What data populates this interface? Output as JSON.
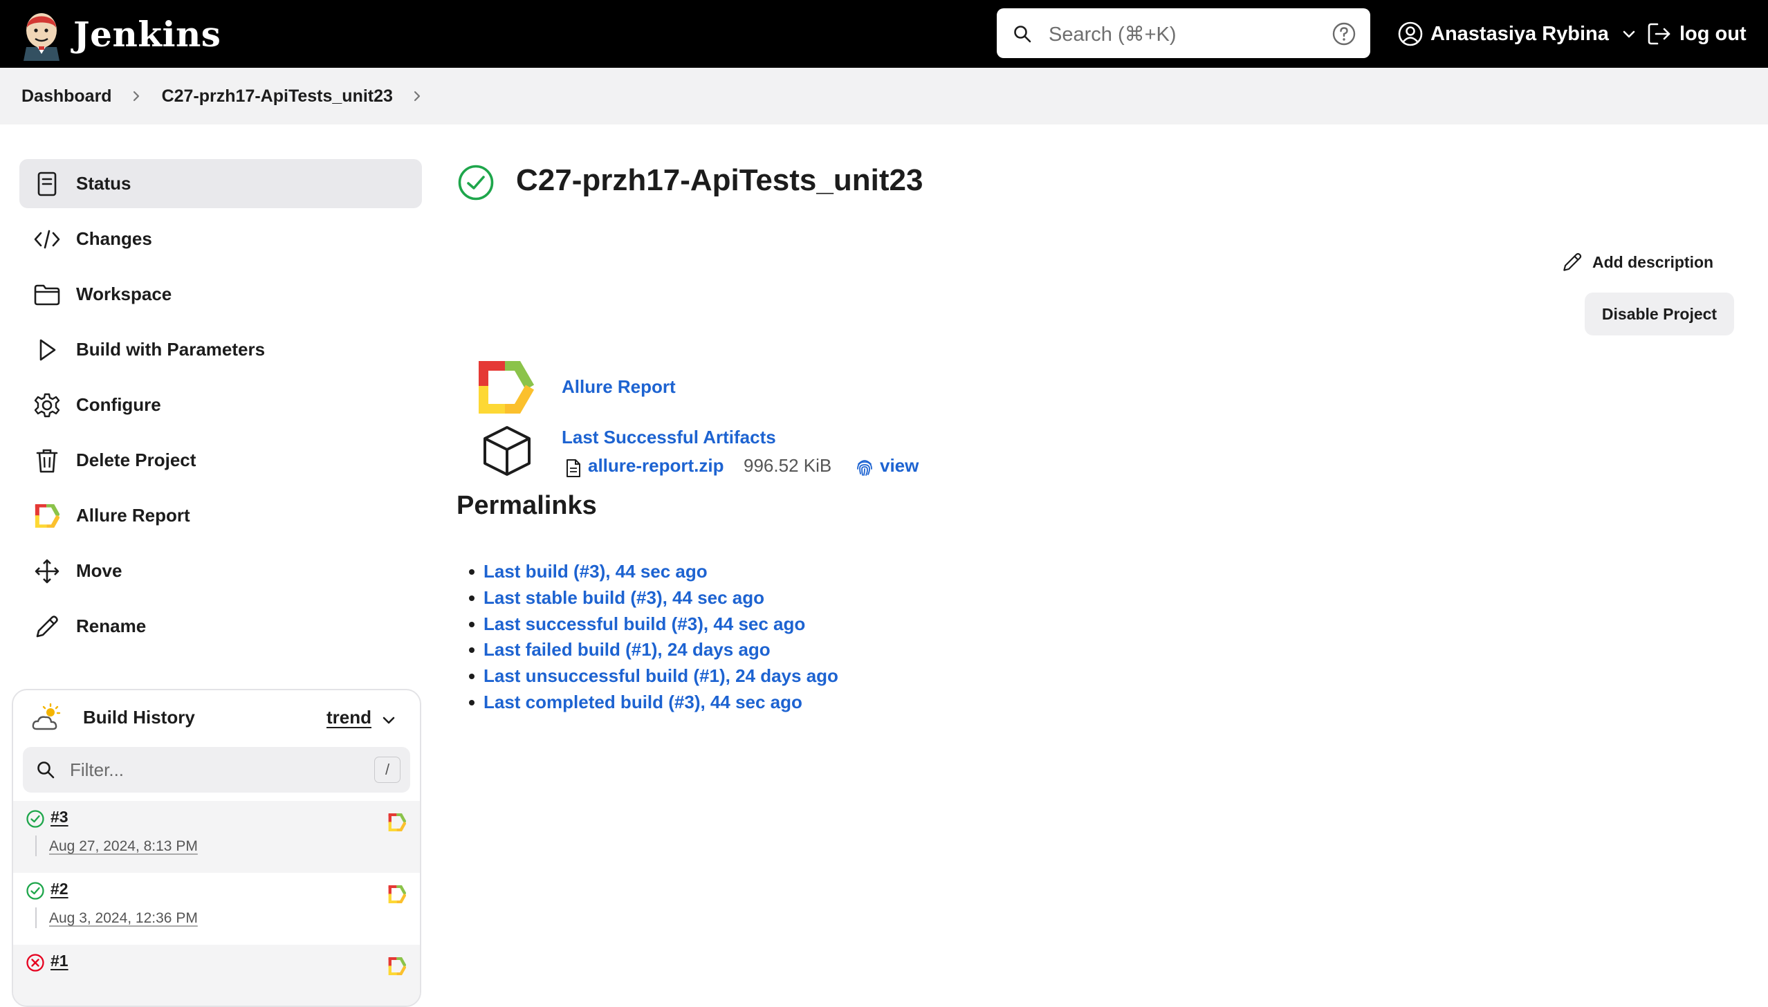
{
  "header": {
    "brand": "Jenkins",
    "search_placeholder": "Search (⌘+K)",
    "user_name": "Anastasiya Rybina",
    "logout_label": "log out"
  },
  "breadcrumb": {
    "items": [
      "Dashboard",
      "C27-przh17-ApiTests_unit23"
    ]
  },
  "sidebar": {
    "items": [
      {
        "label": "Status",
        "icon": "status-page-icon",
        "active": true
      },
      {
        "label": "Changes",
        "icon": "code-icon"
      },
      {
        "label": "Workspace",
        "icon": "folder-icon"
      },
      {
        "label": "Build with Parameters",
        "icon": "play-icon"
      },
      {
        "label": "Configure",
        "icon": "gear-icon"
      },
      {
        "label": "Delete Project",
        "icon": "trash-icon"
      },
      {
        "label": "Allure Report",
        "icon": "allure-icon"
      },
      {
        "label": "Move",
        "icon": "move-arrows-icon"
      },
      {
        "label": "Rename",
        "icon": "pencil-icon"
      }
    ]
  },
  "build_history": {
    "title": "Build History",
    "trend_label": "trend",
    "filter_placeholder": "Filter...",
    "filter_shortcut": "/",
    "builds": [
      {
        "number": "#3",
        "date": "Aug 27, 2024, 8:13 PM",
        "status": "success"
      },
      {
        "number": "#2",
        "date": "Aug 3, 2024, 12:36 PM",
        "status": "success"
      },
      {
        "number": "#1",
        "date": "",
        "status": "failed"
      }
    ]
  },
  "main": {
    "title": "C27-przh17-ApiTests_unit23",
    "add_description_label": "Add description",
    "disable_button_label": "Disable Project",
    "allure_link": "Allure Report",
    "artifacts_link": "Last Successful Artifacts",
    "artifact": {
      "name": "allure-report.zip",
      "size": "996.52 KiB",
      "view_label": "view"
    },
    "permalinks_title": "Permalinks",
    "permalinks": [
      "Last build (#3), 44 sec ago",
      "Last stable build (#3), 44 sec ago",
      "Last successful build (#3), 44 sec ago",
      "Last failed build (#1), 24 days ago",
      "Last unsuccessful build (#1), 24 days ago",
      "Last completed build (#3), 44 sec ago"
    ]
  },
  "colors": {
    "header_bg": "#000000",
    "link_blue": "#1d63d1",
    "success_green": "#1ea64b",
    "failure_red": "#e6001f"
  }
}
